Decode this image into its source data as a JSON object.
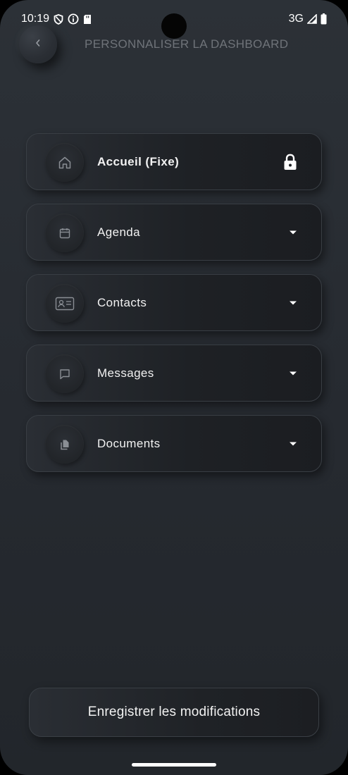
{
  "status_bar": {
    "time": "10:19",
    "network": "3G",
    "icons_left": [
      "shield-icon",
      "info-icon",
      "sd-card-icon"
    ],
    "icons_right": [
      "signal-icon",
      "battery-icon"
    ]
  },
  "header": {
    "title": "PERSONNALISER LA DASHBOARD",
    "back_icon": "chevron-left-icon"
  },
  "sections": [
    {
      "label": "Accueil (Fixe)",
      "icon": "home-icon",
      "action": "lock-icon",
      "locked": true
    },
    {
      "label": "Agenda",
      "icon": "calendar-icon",
      "action": "dropdown-arrow-icon",
      "locked": false
    },
    {
      "label": "Contacts",
      "icon": "contact-card-icon",
      "action": "dropdown-arrow-icon",
      "locked": false
    },
    {
      "label": "Messages",
      "icon": "message-icon",
      "action": "dropdown-arrow-icon",
      "locked": false
    },
    {
      "label": "Documents",
      "icon": "documents-icon",
      "action": "dropdown-arrow-icon",
      "locked": false
    }
  ],
  "save_button": {
    "label": "Enregistrer les modifications"
  },
  "colors": {
    "background": "#2a2e34",
    "card": "#1e2125",
    "title": "#6f7379",
    "text": "#ffffff",
    "icon_muted": "#8a8e94"
  }
}
